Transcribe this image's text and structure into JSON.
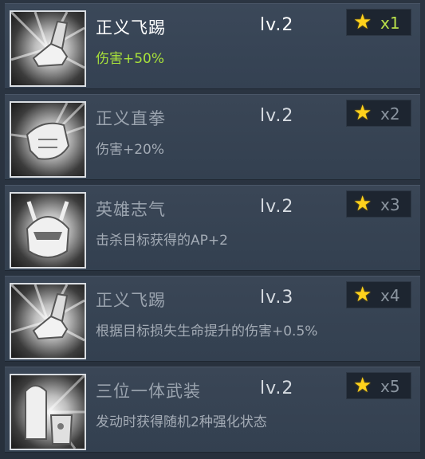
{
  "skills": [
    {
      "name": "正义飞踢",
      "level": "lv.2",
      "description": "伤害+50%",
      "star_icon": "star-icon",
      "multiplier": "x1",
      "icon": "kick-icon",
      "active": true
    },
    {
      "name": "正义直拳",
      "level": "lv.2",
      "description": "伤害+20%",
      "star_icon": "star-icon",
      "multiplier": "x2",
      "icon": "punch-icon",
      "active": false
    },
    {
      "name": "英雄志气",
      "level": "lv.2",
      "description": "击杀目标获得的AP+2",
      "star_icon": "star-icon",
      "multiplier": "x3",
      "icon": "hero-helmet-icon",
      "active": false
    },
    {
      "name": "正义飞踢",
      "level": "lv.3",
      "description": "根据目标损失生命提升的伤害+0.5%",
      "star_icon": "star-icon",
      "multiplier": "x4",
      "icon": "kick-icon",
      "active": false
    },
    {
      "name": "三位一体武装",
      "level": "lv.2",
      "description": "发动时获得随机2种强化状态",
      "star_icon": "star-icon",
      "multiplier": "x5",
      "icon": "armor-icon",
      "active": false
    }
  ],
  "colors": {
    "active_description": "#a9e23a",
    "star": "#ffd21c",
    "active_multiplier": "#b9e04a"
  }
}
